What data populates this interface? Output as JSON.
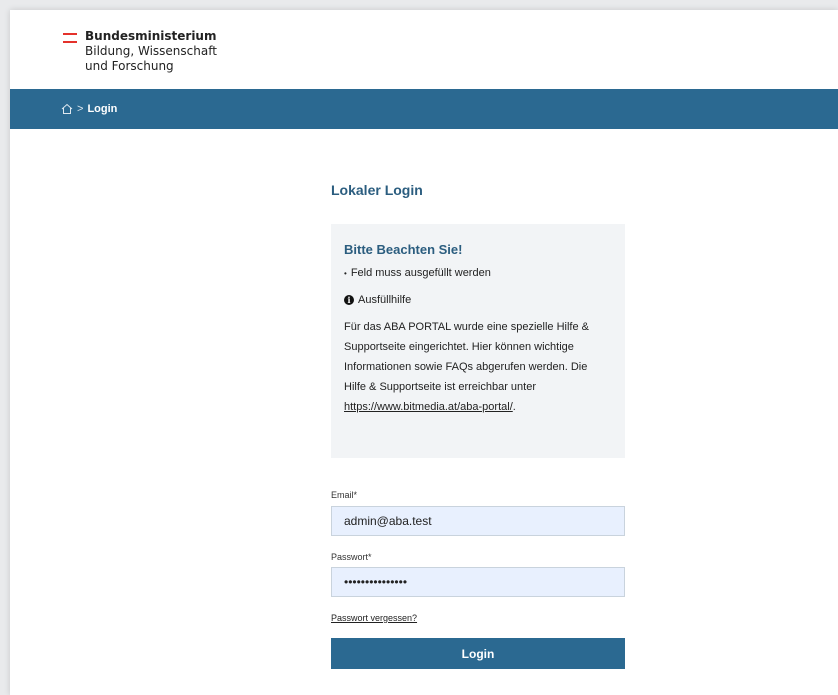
{
  "header": {
    "ministry_line1": "Bundesministerium",
    "ministry_line2": "Bildung, Wissenschaft",
    "ministry_line3": "und Forschung",
    "flag_colors": [
      "#e4322b",
      "#ffffff",
      "#e4322b"
    ]
  },
  "breadcrumb": {
    "home_icon": "home-icon",
    "separator": ">",
    "current": "Login"
  },
  "main": {
    "title": "Lokaler Login",
    "notice": {
      "title": "Bitte Beachten Sie!",
      "required_hint": "Feld muss ausgefüllt werden",
      "help_icon": "info-circle-icon",
      "help_label": "Ausfüllhilfe",
      "body_text": "Für das ABA PORTAL wurde eine spezielle Hilfe & Supportseite eingerichtet. Hier können wichtige Informationen sowie FAQs abgerufen werden. Die Hilfe & Supportseite ist erreichbar unter ",
      "link_text": "https://www.bitmedia.at/aba-portal/",
      "after_link": "."
    },
    "form": {
      "email_label": "Email*",
      "email_value": "admin@aba.test",
      "password_label": "Passwort*",
      "password_value": "•••••••••••••••",
      "forgot_link": "Passwort vergessen?",
      "submit_label": "Login"
    }
  },
  "colors": {
    "nav_bar": "#2b6991",
    "title": "#2b5d7f",
    "input_bg": "#e8f0fe",
    "notice_bg": "#f2f4f6"
  }
}
